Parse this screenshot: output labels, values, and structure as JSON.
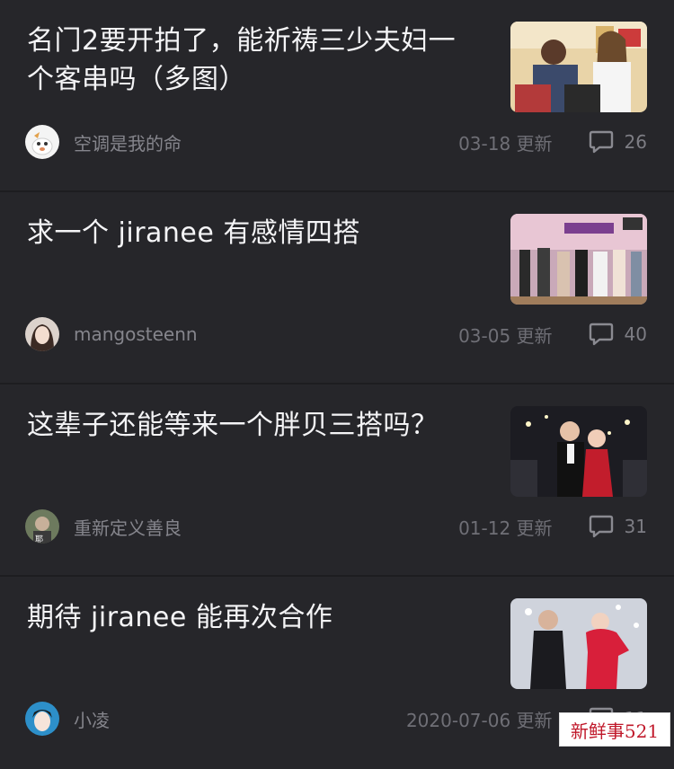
{
  "posts": [
    {
      "title": "名门2要开拍了，能祈祷三少夫妇一个客串吗（多图）",
      "author": "空调是我的命",
      "date": "03-18 更新",
      "comments": "26"
    },
    {
      "title": "求一个 jiranee 有感情四搭",
      "author": "mangosteenn",
      "date": "03-05 更新",
      "comments": "40"
    },
    {
      "title": "这辈子还能等来一个胖贝三搭吗？",
      "author": "重新定义善良",
      "date": "01-12 更新",
      "comments": "31"
    },
    {
      "title": "期待 jiranee 能再次合作",
      "author": "小凌",
      "date": "2020-07-06 更新",
      "comments": "11"
    }
  ],
  "watermark": "新鲜事521",
  "icons": {
    "comment": "comment-bubble-icon"
  },
  "colors": {
    "background": "#26262a",
    "divider": "#1d1d20",
    "title": "#f4f4f6",
    "meta": "#85858c"
  }
}
